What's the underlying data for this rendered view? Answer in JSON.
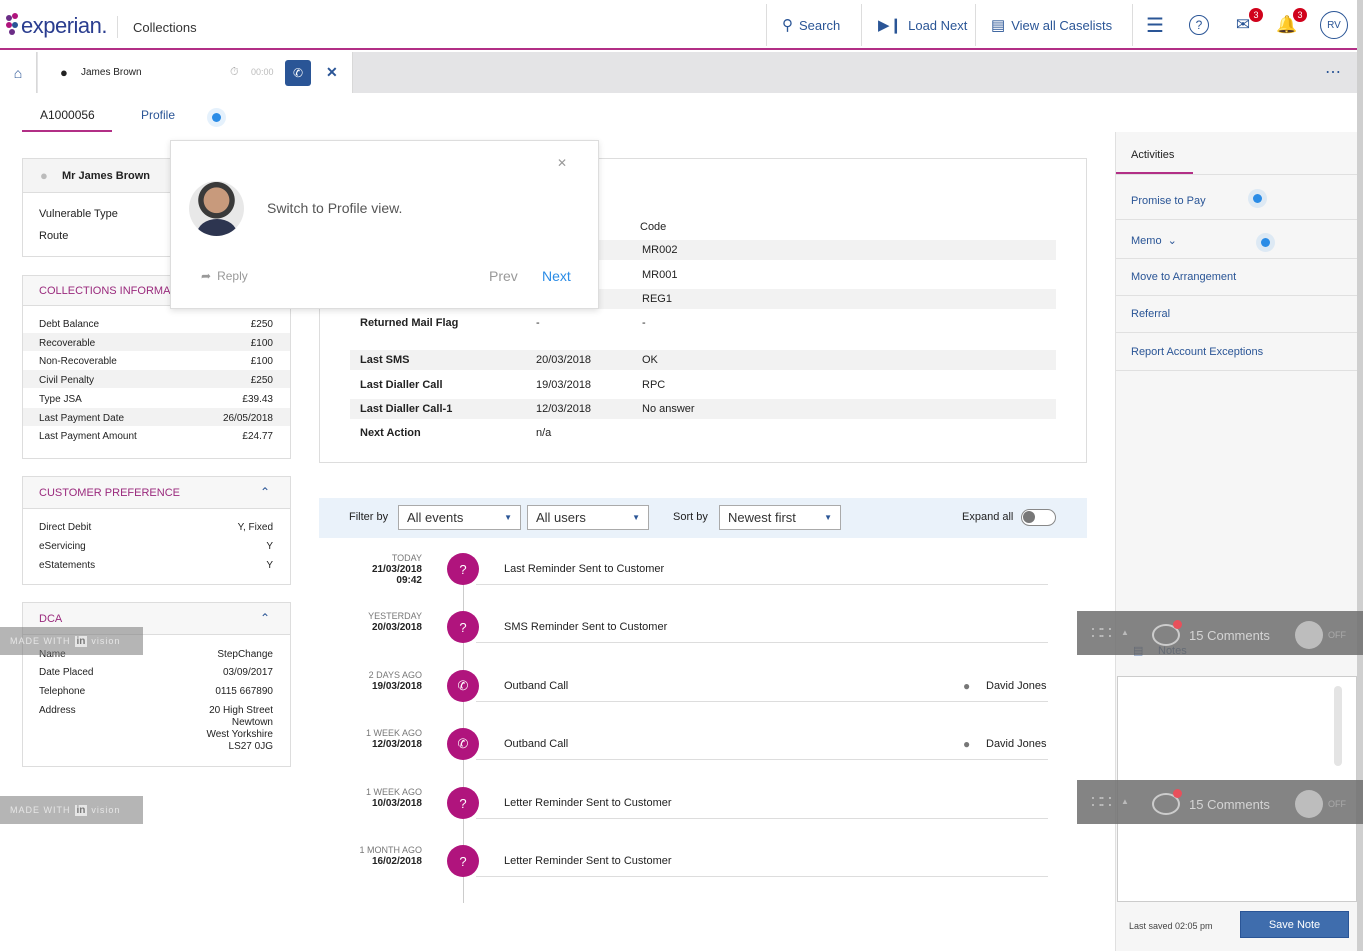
{
  "header": {
    "logo_text": "experian.",
    "app_name": "Collections",
    "search_label": "Search",
    "load_next_label": "Load Next",
    "view_caselists_label": "View all Caselists",
    "mail_badge": "3",
    "bell_badge": "3",
    "avatar_initials": "RV"
  },
  "tab": {
    "customer_name": "James Brown",
    "timer": "00:00"
  },
  "subtabs": [
    "A1000056",
    "Profile"
  ],
  "customer_card": {
    "name": "Mr James Brown",
    "rows": [
      {
        "label": "Vulnerable Type"
      },
      {
        "label": "Route"
      }
    ]
  },
  "collections": {
    "title": "COLLECTIONS INFORMAT",
    "rows": [
      {
        "label": "Debt Balance",
        "value": "£250"
      },
      {
        "label": "Recoverable",
        "value": "£100"
      },
      {
        "label": "Non-Recoverable",
        "value": "£100"
      },
      {
        "label": "Civil Penalty",
        "value": "£250"
      },
      {
        "label": "Type JSA",
        "value": "£39.43"
      },
      {
        "label": "Last Payment Date",
        "value": "26/05/2018"
      },
      {
        "label": "Last Payment Amount",
        "value": "£24.77"
      }
    ]
  },
  "preference": {
    "title": "CUSTOMER PREFERENCE",
    "rows": [
      {
        "label": "Direct Debit",
        "value": "Y, Fixed"
      },
      {
        "label": "eServicing",
        "value": "Y"
      },
      {
        "label": "eStatements",
        "value": "Y"
      }
    ]
  },
  "dca": {
    "title": "DCA",
    "rows": [
      {
        "label": "Name",
        "value": "StepChange"
      },
      {
        "label": "Date Placed",
        "value": "03/09/2017"
      },
      {
        "label": "Telephone",
        "value": "0115  667890"
      },
      {
        "label": "Address",
        "value": "20 High Street\nNewtown\nWest Yorkshire\nLS27 0JG"
      }
    ]
  },
  "flags": {
    "code_header": "Code",
    "rows": [
      {
        "label": "",
        "date": "",
        "code": "MR002"
      },
      {
        "label": "",
        "date": "",
        "code": "MR001"
      },
      {
        "label": "",
        "date": "",
        "code": "REG1"
      },
      {
        "label": "Returned Mail Flag",
        "date": "-",
        "code": "-"
      },
      {
        "label": "Last SMS",
        "date": "20/03/2018",
        "code": "OK"
      },
      {
        "label": "Last Dialler Call",
        "date": "19/03/2018",
        "code": "RPC"
      },
      {
        "label": "Last Dialler Call-1",
        "date": "12/03/2018",
        "code": "No answer"
      },
      {
        "label": "Next Action",
        "date": "n/a",
        "code": ""
      }
    ]
  },
  "popup": {
    "message": "Switch to Profile view.",
    "reply": "Reply",
    "prev": "Prev",
    "next": "Next"
  },
  "filter": {
    "filter_by": "Filter by",
    "events": "All events",
    "users": "All users",
    "sort_by": "Sort by",
    "sort": "Newest first",
    "expand_all": "Expand all"
  },
  "timeline": [
    {
      "rel": "TODAY",
      "date": "21/03/2018",
      "time": "09:42",
      "title": "Last Reminder Sent to Customer",
      "user": "",
      "icon": "question-icon"
    },
    {
      "rel": "YESTERDAY",
      "date": "20/03/2018",
      "time": "",
      "title": "SMS Reminder Sent to Customer",
      "user": "",
      "icon": "question-icon"
    },
    {
      "rel": "2 DAYS AGO",
      "date": "19/03/2018",
      "time": "",
      "title": "Outband Call",
      "user": "David Jones",
      "icon": "phone-icon"
    },
    {
      "rel": "1 WEEK AGO",
      "date": "12/03/2018",
      "time": "",
      "title": "Outband Call",
      "user": "David Jones",
      "icon": "phone-icon"
    },
    {
      "rel": "1 WEEK AGO",
      "date": "10/03/2018",
      "time": "",
      "title": "Letter Reminder Sent to Customer",
      "user": "",
      "icon": "question-icon"
    },
    {
      "rel": "1 MONTH AGO",
      "date": "16/02/2018",
      "time": "",
      "title": "Letter Reminder Sent to Customer",
      "user": "",
      "icon": "question-icon"
    }
  ],
  "activities": {
    "title": "Activities",
    "items": [
      "Promise to Pay",
      "Memo",
      "Move to Arrangement",
      "Referral",
      "Report Account Exceptions"
    ]
  },
  "notes": {
    "title": "Notes",
    "last_saved": "Last saved 02:05 pm",
    "save_label": "Save Note"
  },
  "invision": {
    "comments": "15 Comments",
    "off": "OFF",
    "made_with": "MADE WITH",
    "brand_in": "in",
    "brand_rest": "vision"
  },
  "colors": {
    "brand_blue": "#2a5596",
    "accent_magenta": "#b0147d",
    "badge_red": "#d0021b"
  }
}
